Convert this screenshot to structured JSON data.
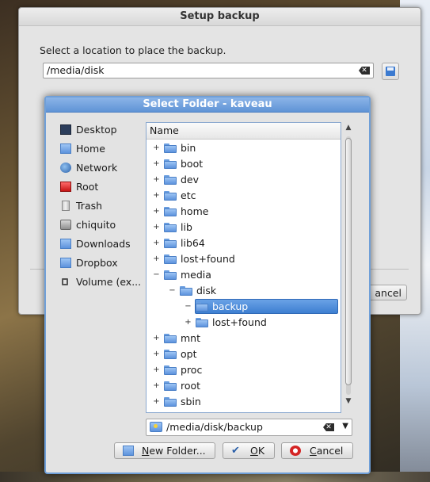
{
  "setup_backup": {
    "title": "Setup backup",
    "prompt": "Select a location to place the backup.",
    "path_value": "/media/disk",
    "cancel_label": "ancel"
  },
  "select_folder": {
    "title": "Select Folder - kaveau",
    "places": [
      {
        "label": "Desktop",
        "icon": "desktop-icon"
      },
      {
        "label": "Home",
        "icon": "home-icon"
      },
      {
        "label": "Network",
        "icon": "network-icon"
      },
      {
        "label": "Root",
        "icon": "root-folder-icon"
      },
      {
        "label": "Trash",
        "icon": "trash-icon"
      },
      {
        "label": "chiquito",
        "icon": "drive-icon"
      },
      {
        "label": "Downloads",
        "icon": "folder-icon"
      },
      {
        "label": "Dropbox",
        "icon": "folder-icon"
      },
      {
        "label": "Volume (ex...",
        "icon": "lock-icon"
      }
    ],
    "tree_header": "Name",
    "tree": [
      {
        "name": "bin",
        "expander": "+",
        "depth": 0
      },
      {
        "name": "boot",
        "expander": "+",
        "depth": 0
      },
      {
        "name": "dev",
        "expander": "+",
        "depth": 0
      },
      {
        "name": "etc",
        "expander": "+",
        "depth": 0
      },
      {
        "name": "home",
        "expander": "+",
        "depth": 0
      },
      {
        "name": "lib",
        "expander": "+",
        "depth": 0
      },
      {
        "name": "lib64",
        "expander": "+",
        "depth": 0
      },
      {
        "name": "lost+found",
        "expander": "+",
        "depth": 0
      },
      {
        "name": "media",
        "expander": "−",
        "depth": 0
      },
      {
        "name": "disk",
        "expander": "−",
        "depth": 1
      },
      {
        "name": "backup",
        "expander": "−",
        "depth": 2,
        "selected": true
      },
      {
        "name": "lost+found",
        "expander": "+",
        "depth": 2
      },
      {
        "name": "mnt",
        "expander": "+",
        "depth": 0
      },
      {
        "name": "opt",
        "expander": "+",
        "depth": 0
      },
      {
        "name": "proc",
        "expander": "+",
        "depth": 0
      },
      {
        "name": "root",
        "expander": "+",
        "depth": 0
      },
      {
        "name": "sbin",
        "expander": "+",
        "depth": 0
      }
    ],
    "path_value": "/media/disk/backup",
    "buttons": {
      "new_folder": {
        "mnemonic": "N",
        "rest": "ew Folder..."
      },
      "ok": {
        "mnemonic": "O",
        "rest": "K"
      },
      "cancel": {
        "mnemonic": "C",
        "rest": "ancel"
      }
    }
  },
  "colors": {
    "selection": "#3d7fd1",
    "titlebar_active": "#5f93d6",
    "folder_blue": "#5d93dd"
  }
}
